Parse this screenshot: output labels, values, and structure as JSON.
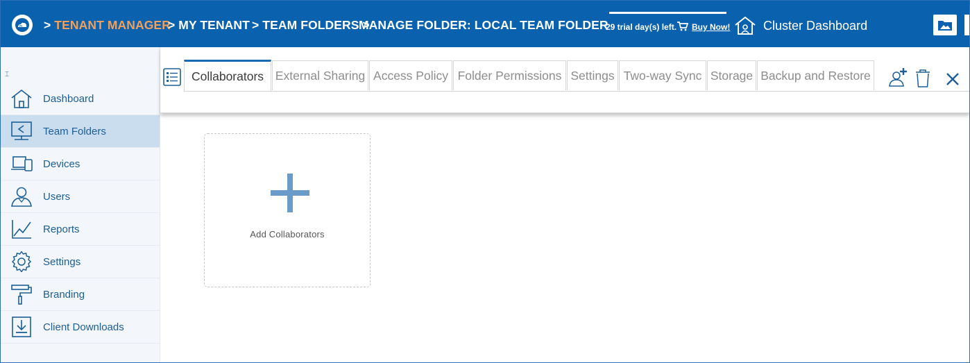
{
  "header": {
    "breadcrumb": [
      {
        "sep": "> ",
        "label": "TENANT MANAGER"
      },
      {
        "label": "> MY TENANT"
      },
      {
        "label": "> TEAM FOLDERS >"
      },
      {
        "label": "MANAGE FOLDER: LOCAL TEAM FOLDER"
      }
    ],
    "trial_text": "29 trial day(s) left.",
    "buy_now": "Buy Now!",
    "cluster_dashboard": "Cluster Dashboard"
  },
  "sidebar": {
    "collapse_glyph": "⌶",
    "items": [
      {
        "label": "Dashboard",
        "icon": "house-icon",
        "active": false
      },
      {
        "label": "Team Folders",
        "icon": "share-folder-icon",
        "active": true
      },
      {
        "label": "Devices",
        "icon": "devices-icon",
        "active": false
      },
      {
        "label": "Users",
        "icon": "user-icon",
        "active": false
      },
      {
        "label": "Reports",
        "icon": "chart-icon",
        "active": false
      },
      {
        "label": "Settings",
        "icon": "gear-icon",
        "active": false
      },
      {
        "label": "Branding",
        "icon": "paint-roller-icon",
        "active": false
      },
      {
        "label": "Client Downloads",
        "icon": "download-icon",
        "active": false
      }
    ]
  },
  "tabs": [
    {
      "label": "Collaborators",
      "active": true
    },
    {
      "label": "External Sharing",
      "active": false
    },
    {
      "label": "Access Policy",
      "active": false
    },
    {
      "label": "Folder Permissions",
      "active": false
    },
    {
      "label": "Settings",
      "active": false
    },
    {
      "label": "Two-way Sync",
      "active": false
    },
    {
      "label": "Storage",
      "active": false
    },
    {
      "label": "Backup and Restore",
      "active": false
    }
  ],
  "main": {
    "add_card_label": "Add Collaborators"
  },
  "colors": {
    "header_bg": "#0a62ae",
    "accent_orange": "#f0a05c",
    "sidebar_bg": "#f3f6fb",
    "sidebar_active": "#c9ddef",
    "nav_text": "#1d5e96",
    "plus_blue": "#6b9bc8"
  }
}
